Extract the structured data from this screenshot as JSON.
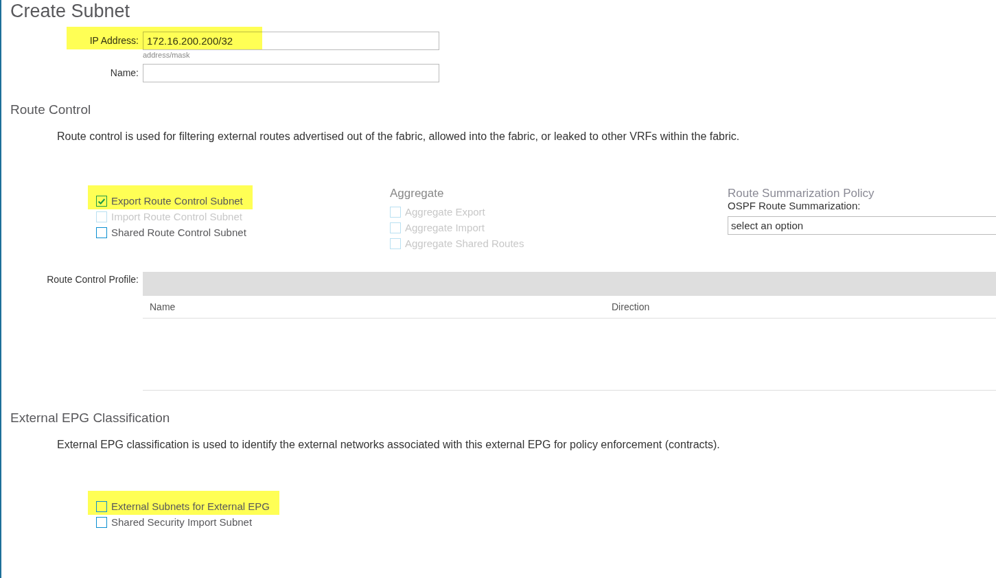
{
  "title": "Create Subnet",
  "fields": [
    {
      "label": "IP Address:",
      "value": "172.16.200.200/32",
      "hint": "address/mask",
      "highlighted": true
    },
    {
      "label": "Name:",
      "highlighted": false
    }
  ],
  "route_control": {
    "heading": "Route Control",
    "description": "Route control is used for filtering external routes advertised out of the fabric, allowed into the fabric, or leaked to other VRFs within the fabric.",
    "options": [
      {
        "label": "Export Route Control Subnet",
        "checked": true,
        "disabled": false,
        "highlighted": true
      },
      {
        "label": "Import Route Control Subnet",
        "checked": false,
        "disabled": true,
        "highlighted": false
      },
      {
        "label": "Shared Route Control Subnet",
        "checked": false,
        "disabled": false,
        "highlighted": false
      }
    ],
    "aggregate": {
      "heading": "Aggregate",
      "options": [
        {
          "label": "Aggregate Export",
          "checked": false,
          "disabled": true,
          "highlighted": false
        },
        {
          "label": "Aggregate Import",
          "checked": false,
          "disabled": true,
          "highlighted": false
        },
        {
          "label": "Aggregate Shared Routes",
          "checked": false,
          "disabled": true,
          "highlighted": false
        }
      ]
    },
    "summarization": {
      "heading": "Route Summarization Policy",
      "label": "OSPF Route Summarization:",
      "placeholder": "select an option"
    },
    "profile": {
      "label": "Route Control Profile:",
      "columns": [
        "Name",
        "Direction"
      ]
    }
  },
  "external_epg": {
    "heading": "External EPG Classification",
    "description": "External EPG classification is used to identify the external networks associated with this external EPG for policy enforcement (contracts).",
    "options": [
      {
        "label": "External Subnets for External EPG",
        "checked": false,
        "disabled": false,
        "highlighted": true
      },
      {
        "label": "Shared Security Import Subnet",
        "checked": false,
        "disabled": false,
        "highlighted": false
      }
    ]
  }
}
